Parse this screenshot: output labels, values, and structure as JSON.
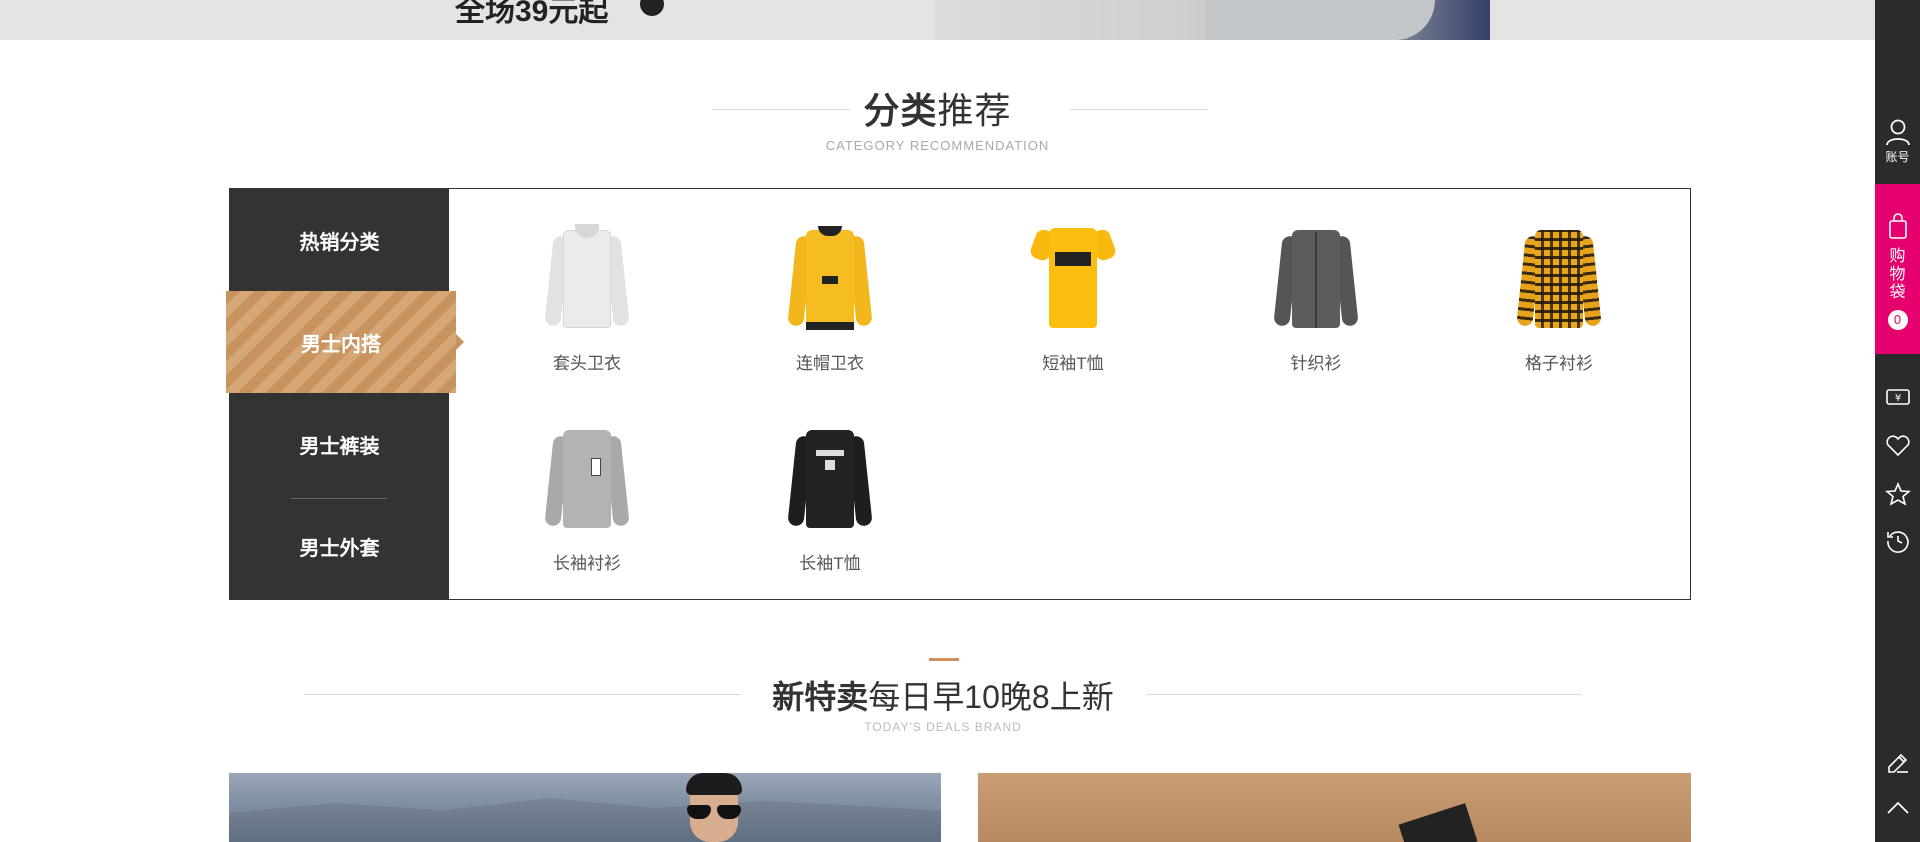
{
  "top_banner": {
    "promo_text": "全场39元起"
  },
  "category_section": {
    "title_bold": "分类",
    "title_rest": "推荐",
    "subtitle": "CATEGORY RECOMMENDATION",
    "tabs": [
      {
        "label": "热销分类",
        "active": false
      },
      {
        "label": "男士内搭",
        "active": true
      },
      {
        "label": "男士裤装",
        "active": false
      },
      {
        "label": "男士外套",
        "active": false
      }
    ],
    "items": [
      {
        "label": "套头卫衣",
        "icon": "pullover-sweatshirt-icon"
      },
      {
        "label": "连帽卫衣",
        "icon": "hoodie-icon"
      },
      {
        "label": "短袖T恤",
        "icon": "short-sleeve-tshirt-icon"
      },
      {
        "label": "针织衫",
        "icon": "knit-cardigan-icon"
      },
      {
        "label": "格子衬衫",
        "icon": "plaid-shirt-icon"
      },
      {
        "label": "长袖衬衫",
        "icon": "long-sleeve-shirt-icon"
      },
      {
        "label": "长袖T恤",
        "icon": "long-sleeve-tshirt-icon"
      }
    ]
  },
  "deals_section": {
    "title_bold": "新特卖",
    "title_rest": "每日早10晚8上新",
    "subtitle": "TODAY'S DEALS BRAND",
    "accent_color": "#c8935f"
  },
  "sidebar": {
    "account_label": "账号",
    "cart_label": "购物袋",
    "cart_count": "0",
    "cart_color": "#e5006e",
    "icons": [
      "coupon-icon",
      "heart-icon",
      "star-icon",
      "history-icon",
      "edit-icon",
      "back-to-top-icon"
    ]
  }
}
